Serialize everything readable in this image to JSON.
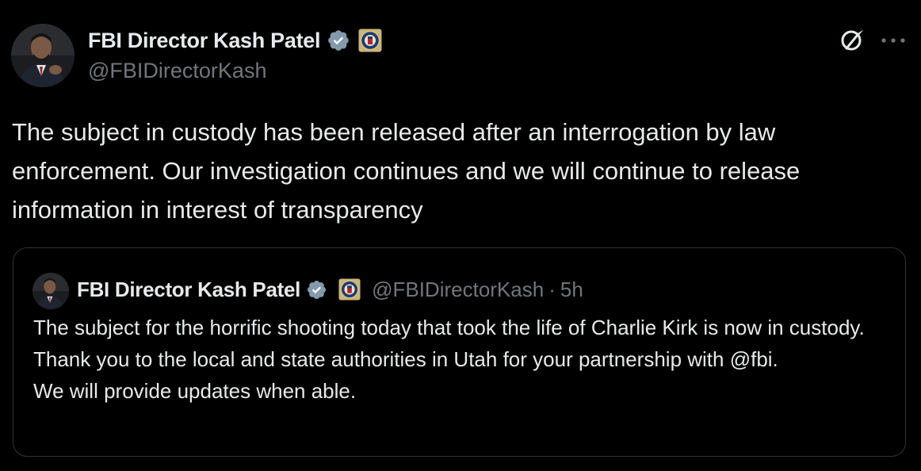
{
  "colors": {
    "background": "#000000",
    "text_primary": "#e7e9ea",
    "text_secondary": "#71767b",
    "verified_badge": "#829aab",
    "border": "#2f3336"
  },
  "post": {
    "author_name": "FBI Director Kash Patel",
    "author_handle": "@FBIDirectorKash",
    "verified_icon": "verified-badge-icon",
    "affiliation_icon": "fbi-seal-icon",
    "text": "The subject in custody has been released after an interrogation by law enforcement.  Our investigation continues and we will continue to release information in interest of transparency",
    "actions": {
      "grok_icon": "grok-icon",
      "more_icon": "more-options-icon"
    }
  },
  "quoted_post": {
    "author_name": "FBI Director Kash Patel",
    "author_handle": "@FBIDirectorKash",
    "separator": "·",
    "timestamp": "5h",
    "lines": [
      "The subject for the horrific shooting today that took the life of Charlie Kirk is now in custody. Thank you to the local and state authorities in Utah for your partnership with @fbi.",
      "We will provide updates when able."
    ]
  }
}
